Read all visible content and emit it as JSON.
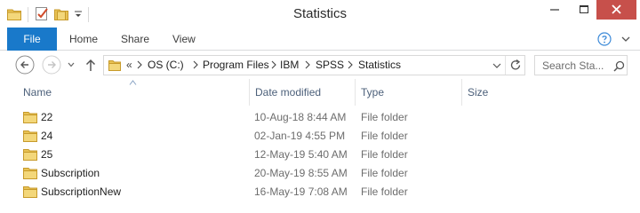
{
  "window": {
    "title": "Statistics"
  },
  "ribbon": {
    "tabs": [
      {
        "label": "File"
      },
      {
        "label": "Home"
      },
      {
        "label": "Share"
      },
      {
        "label": "View"
      }
    ]
  },
  "addressbar": {
    "overflow": "«",
    "breadcrumbs": [
      "OS (C:)",
      "Program Files",
      "IBM",
      "SPSS",
      "Statistics"
    ]
  },
  "search": {
    "placeholder": "Search Sta..."
  },
  "columns": {
    "name": "Name",
    "date_modified": "Date modified",
    "type": "Type",
    "size": "Size"
  },
  "files": [
    {
      "name": "22",
      "date": "10-Aug-18 8:44 AM",
      "type": "File folder"
    },
    {
      "name": "24",
      "date": "02-Jan-19 4:55 PM",
      "type": "File folder"
    },
    {
      "name": "25",
      "date": "12-May-19 5:40 AM",
      "type": "File folder"
    },
    {
      "name": "Subscription",
      "date": "20-May-19 8:55 AM",
      "type": "File folder"
    },
    {
      "name": "SubscriptionNew",
      "date": "16-May-19 7:08 AM",
      "type": "File folder"
    }
  ],
  "icons": {
    "folder": "folder-icon",
    "properties": "properties-icon",
    "new_folder": "new-folder-icon",
    "back": "back-arrow-icon",
    "forward": "forward-arrow-icon",
    "up": "up-arrow-icon",
    "refresh": "refresh-icon",
    "search": "search-icon",
    "help": "help-icon"
  },
  "colors": {
    "file_tab": "#1979ca",
    "close_button": "#c7504b",
    "folder_yellow": "#e8c254",
    "header_text": "#4c607a"
  }
}
